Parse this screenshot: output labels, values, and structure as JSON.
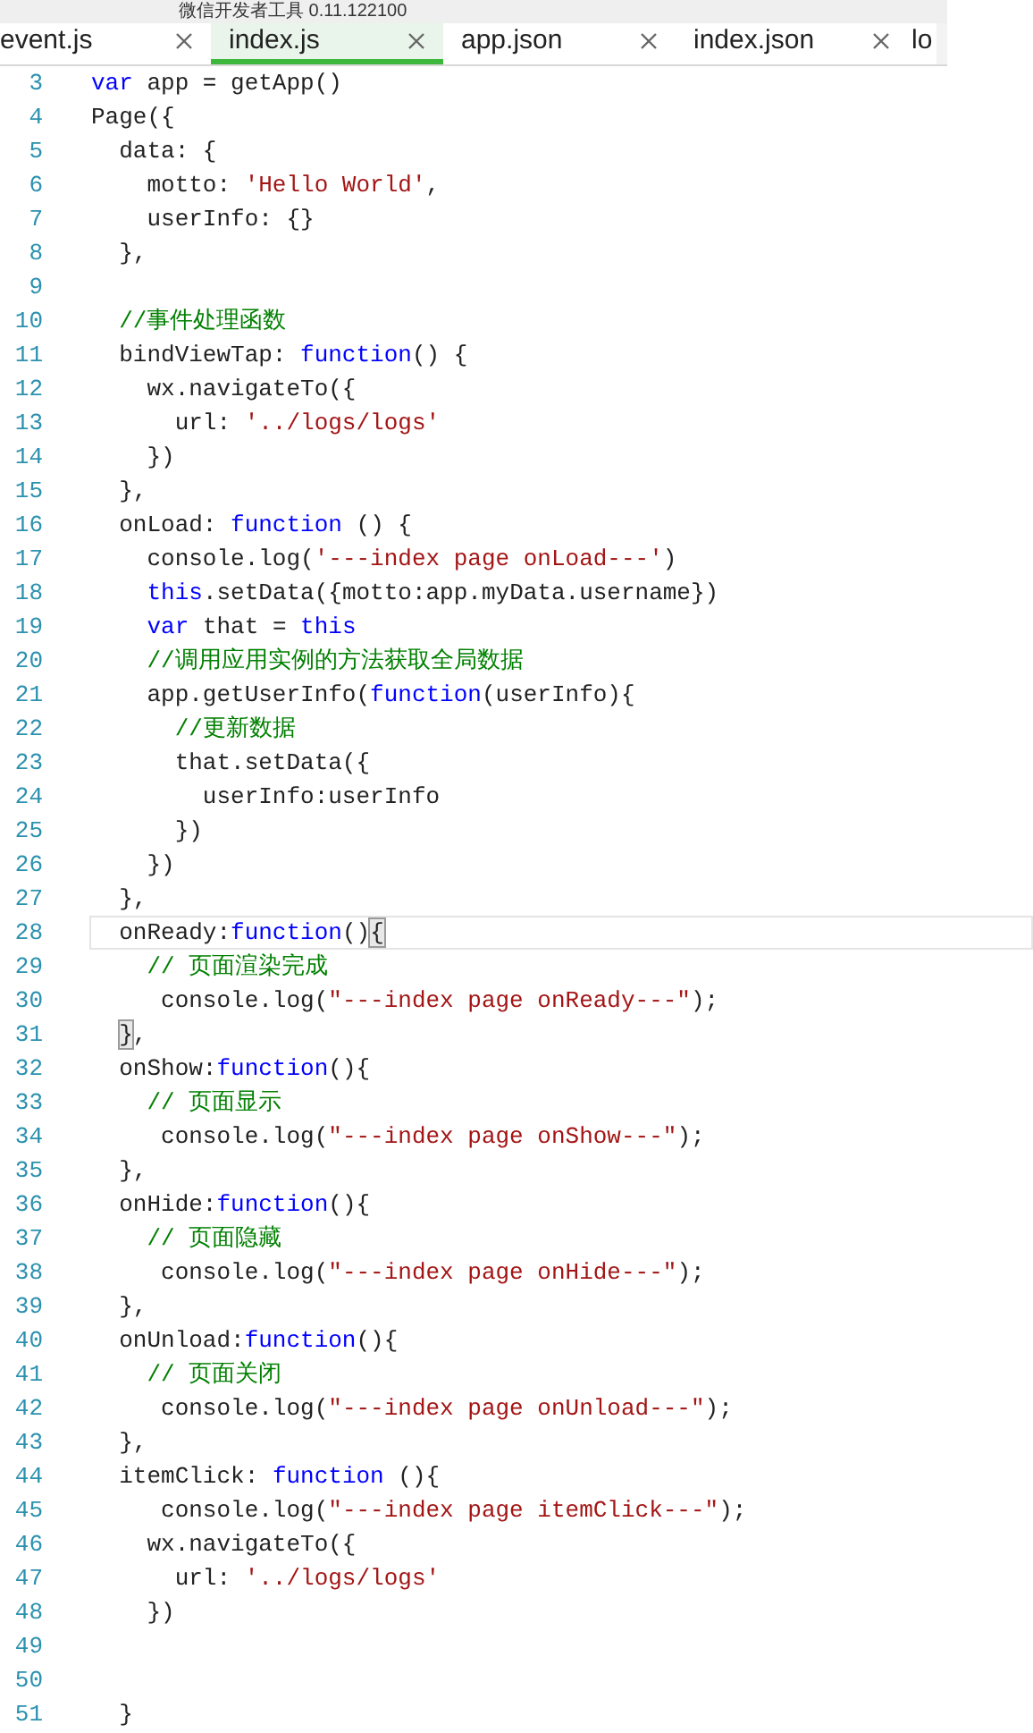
{
  "window": {
    "title": "微信开发者工具 0.11.122100"
  },
  "tabs": [
    {
      "label": "event.js",
      "selected": false,
      "closable": true
    },
    {
      "label": "index.js",
      "selected": true,
      "closable": true
    },
    {
      "label": "app.json",
      "selected": false,
      "closable": true
    },
    {
      "label": "index.json",
      "selected": false,
      "closable": true
    },
    {
      "label": "lo",
      "selected": false,
      "closable": false
    }
  ],
  "editor": {
    "lines": [
      {
        "number": "3",
        "current": false,
        "tokens": [
          {
            "kind": "keyword",
            "text": "var"
          },
          {
            "kind": "plain",
            "text": " app = getApp()"
          }
        ]
      },
      {
        "number": "4",
        "current": false,
        "tokens": [
          {
            "kind": "plain",
            "text": "Page({"
          }
        ]
      },
      {
        "number": "5",
        "current": false,
        "tokens": [
          {
            "kind": "plain",
            "text": "  data: {"
          }
        ]
      },
      {
        "number": "6",
        "current": false,
        "tokens": [
          {
            "kind": "plain",
            "text": "    motto: "
          },
          {
            "kind": "string",
            "text": "'Hello World'"
          },
          {
            "kind": "plain",
            "text": ","
          }
        ]
      },
      {
        "number": "7",
        "current": false,
        "tokens": [
          {
            "kind": "plain",
            "text": "    userInfo: {}"
          }
        ]
      },
      {
        "number": "8",
        "current": false,
        "tokens": [
          {
            "kind": "plain",
            "text": "  },"
          }
        ]
      },
      {
        "number": "9",
        "current": false
      },
      {
        "number": "10",
        "current": false,
        "tokens": [
          {
            "kind": "comment",
            "text": "  //事件处理函数"
          }
        ]
      },
      {
        "number": "11",
        "current": false,
        "tokens": [
          {
            "kind": "plain",
            "text": "  bindViewTap: "
          },
          {
            "kind": "keyword",
            "text": "function"
          },
          {
            "kind": "plain",
            "text": "() {"
          }
        ]
      },
      {
        "number": "12",
        "current": false,
        "tokens": [
          {
            "kind": "plain",
            "text": "    wx.navigateTo({"
          }
        ]
      },
      {
        "number": "13",
        "current": false,
        "tokens": [
          {
            "kind": "plain",
            "text": "      url: "
          },
          {
            "kind": "string",
            "text": "'../logs/logs'"
          }
        ]
      },
      {
        "number": "14",
        "current": false,
        "tokens": [
          {
            "kind": "plain",
            "text": "    })"
          }
        ]
      },
      {
        "number": "15",
        "current": false,
        "tokens": [
          {
            "kind": "plain",
            "text": "  },"
          }
        ]
      },
      {
        "number": "16",
        "current": false,
        "tokens": [
          {
            "kind": "plain",
            "text": "  onLoad: "
          },
          {
            "kind": "keyword",
            "text": "function"
          },
          {
            "kind": "plain",
            "text": " () {"
          }
        ]
      },
      {
        "number": "17",
        "current": false,
        "tokens": [
          {
            "kind": "plain",
            "text": "    console.log("
          },
          {
            "kind": "string",
            "text": "'---index page onLoad---'"
          },
          {
            "kind": "plain",
            "text": ")"
          }
        ]
      },
      {
        "number": "18",
        "current": false,
        "tokens": [
          {
            "kind": "keyword",
            "text": "    this"
          },
          {
            "kind": "plain",
            "text": ".setData({motto:app.myData.username})"
          }
        ]
      },
      {
        "number": "19",
        "current": false,
        "tokens": [
          {
            "kind": "keyword",
            "text": "    var"
          },
          {
            "kind": "plain",
            "text": " that = "
          },
          {
            "kind": "keyword",
            "text": "this"
          }
        ]
      },
      {
        "number": "20",
        "current": false,
        "tokens": [
          {
            "kind": "comment",
            "text": "    //调用应用实例的方法获取全局数据"
          }
        ]
      },
      {
        "number": "21",
        "current": false,
        "tokens": [
          {
            "kind": "plain",
            "text": "    app.getUserInfo("
          },
          {
            "kind": "keyword",
            "text": "function"
          },
          {
            "kind": "plain",
            "text": "(userInfo){"
          }
        ]
      },
      {
        "number": "22",
        "current": false,
        "tokens": [
          {
            "kind": "comment",
            "text": "      //更新数据"
          }
        ]
      },
      {
        "number": "23",
        "current": false,
        "tokens": [
          {
            "kind": "plain",
            "text": "      that.setData({"
          }
        ]
      },
      {
        "number": "24",
        "current": false,
        "tokens": [
          {
            "kind": "plain",
            "text": "        userInfo:userInfo"
          }
        ]
      },
      {
        "number": "25",
        "current": false,
        "tokens": [
          {
            "kind": "plain",
            "text": "      })"
          }
        ]
      },
      {
        "number": "26",
        "current": false,
        "tokens": [
          {
            "kind": "plain",
            "text": "    })"
          }
        ]
      },
      {
        "number": "27",
        "current": false,
        "tokens": [
          {
            "kind": "plain",
            "text": "  },"
          }
        ]
      },
      {
        "number": "28",
        "current": true,
        "tokens": [
          {
            "kind": "plain",
            "text": "  onReady:"
          },
          {
            "kind": "keyword",
            "text": "function"
          },
          {
            "kind": "plain",
            "text": "()"
          },
          {
            "kind": "bracket",
            "text": "{"
          }
        ]
      },
      {
        "number": "29",
        "current": false,
        "tokens": [
          {
            "kind": "comment",
            "text": "    // 页面渲染完成"
          }
        ]
      },
      {
        "number": "30",
        "current": false,
        "tokens": [
          {
            "kind": "plain",
            "text": "     console.log("
          },
          {
            "kind": "string",
            "text": "\"---index page onReady---\""
          },
          {
            "kind": "plain",
            "text": ");"
          }
        ]
      },
      {
        "number": "31",
        "current": false,
        "tokens": [
          {
            "kind": "bracket",
            "text": "  }"
          },
          {
            "kind": "plain",
            "text": ","
          }
        ]
      },
      {
        "number": "32",
        "current": false,
        "tokens": [
          {
            "kind": "plain",
            "text": "  onShow:"
          },
          {
            "kind": "keyword",
            "text": "function"
          },
          {
            "kind": "plain",
            "text": "(){"
          }
        ]
      },
      {
        "number": "33",
        "current": false,
        "tokens": [
          {
            "kind": "comment",
            "text": "    // 页面显示"
          }
        ]
      },
      {
        "number": "34",
        "current": false,
        "tokens": [
          {
            "kind": "plain",
            "text": "     console.log("
          },
          {
            "kind": "string",
            "text": "\"---index page onShow---\""
          },
          {
            "kind": "plain",
            "text": ");"
          }
        ]
      },
      {
        "number": "35",
        "current": false,
        "tokens": [
          {
            "kind": "plain",
            "text": "  },"
          }
        ]
      },
      {
        "number": "36",
        "current": false,
        "tokens": [
          {
            "kind": "plain",
            "text": "  onHide:"
          },
          {
            "kind": "keyword",
            "text": "function"
          },
          {
            "kind": "plain",
            "text": "(){"
          }
        ]
      },
      {
        "number": "37",
        "current": false,
        "tokens": [
          {
            "kind": "comment",
            "text": "    // 页面隐藏"
          }
        ]
      },
      {
        "number": "38",
        "current": false,
        "tokens": [
          {
            "kind": "plain",
            "text": "     console.log("
          },
          {
            "kind": "string",
            "text": "\"---index page onHide---\""
          },
          {
            "kind": "plain",
            "text": ");"
          }
        ]
      },
      {
        "number": "39",
        "current": false,
        "tokens": [
          {
            "kind": "plain",
            "text": "  },"
          }
        ]
      },
      {
        "number": "40",
        "current": false,
        "tokens": [
          {
            "kind": "plain",
            "text": "  onUnload:"
          },
          {
            "kind": "keyword",
            "text": "function"
          },
          {
            "kind": "plain",
            "text": "(){"
          }
        ]
      },
      {
        "number": "41",
        "current": false,
        "tokens": [
          {
            "kind": "comment",
            "text": "    // 页面关闭"
          }
        ]
      },
      {
        "number": "42",
        "current": false,
        "tokens": [
          {
            "kind": "plain",
            "text": "     console.log("
          },
          {
            "kind": "string",
            "text": "\"---index page onUnload---\""
          },
          {
            "kind": "plain",
            "text": ");"
          }
        ]
      },
      {
        "number": "43",
        "current": false,
        "tokens": [
          {
            "kind": "plain",
            "text": "  },"
          }
        ]
      },
      {
        "number": "44",
        "current": false,
        "tokens": [
          {
            "kind": "plain",
            "text": "  itemClick: "
          },
          {
            "kind": "keyword",
            "text": "function"
          },
          {
            "kind": "plain",
            "text": " (){"
          }
        ]
      },
      {
        "number": "45",
        "current": false,
        "tokens": [
          {
            "kind": "plain",
            "text": "     console.log("
          },
          {
            "kind": "string",
            "text": "\"---index page itemClick---\""
          },
          {
            "kind": "plain",
            "text": ");"
          }
        ]
      },
      {
        "number": "46",
        "current": false,
        "tokens": [
          {
            "kind": "plain",
            "text": "    wx.navigateTo({"
          }
        ]
      },
      {
        "number": "47",
        "current": false,
        "tokens": [
          {
            "kind": "plain",
            "text": "      url: "
          },
          {
            "kind": "string",
            "text": "'../logs/logs'"
          }
        ]
      },
      {
        "number": "48",
        "current": false,
        "tokens": [
          {
            "kind": "plain",
            "text": "    })"
          }
        ]
      },
      {
        "number": "49",
        "current": false
      },
      {
        "number": "50",
        "current": false
      },
      {
        "number": "51",
        "current": false,
        "tokens": [
          {
            "kind": "plain",
            "text": "  }"
          }
        ]
      }
    ]
  }
}
